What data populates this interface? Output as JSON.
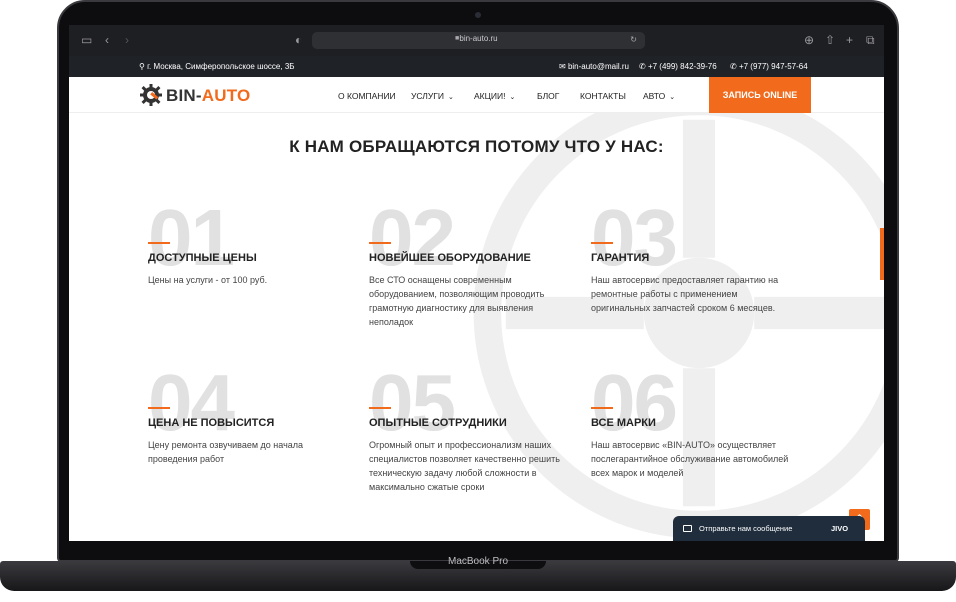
{
  "browser": {
    "url": "bin-auto.ru"
  },
  "topbar": {
    "address": "г. Москва, Симферопольское шоссе, 3Б",
    "email": "bin-auto@mail.ru",
    "phone1": "+7 (499) 842-39-76",
    "phone2": "+7 (977) 947-57-64"
  },
  "logo": {
    "part1": "BIN-",
    "part2": "AUTO"
  },
  "nav": {
    "items": [
      {
        "label": "О компании"
      },
      {
        "label": "Услуги"
      },
      {
        "label": "Акции!"
      },
      {
        "label": "Блог"
      },
      {
        "label": "Контакты"
      },
      {
        "label": "Авто"
      }
    ],
    "cta": "ЗАПИСЬ ONLINE"
  },
  "section": {
    "title": "К НАМ ОБРАЩАЮТСЯ ПОТОМУ ЧТО У НАС:",
    "features": [
      {
        "num": "01",
        "title": "Доступные цены",
        "text": "Цены на услуги - от 100 руб."
      },
      {
        "num": "02",
        "title": "Новейшее оборудование",
        "text": "Все СТО оснащены современным оборудованием, позволяющим проводить грамотную диагностику для выявления неполадок"
      },
      {
        "num": "03",
        "title": "Гарантия",
        "text": "Наш автосервис предоставляет гарантию на ремонтные работы с применением оригинальных запчастей сроком 6 месяцев."
      },
      {
        "num": "04",
        "title": "Цена не повысится",
        "text": "Цену ремонта озвучиваем до начала проведения работ"
      },
      {
        "num": "05",
        "title": "Опытные сотрудники",
        "text": "Огромный опыт и профессионализм наших специалистов позволяет качественно решить техническую задачу любой сложности в максимально сжатые сроки"
      },
      {
        "num": "06",
        "title": "Все марки",
        "text": "Наш автосервис «BIN-AUTO» осуществляет послегарантийное обслуживание автомобилей всех марок и моделей"
      }
    ]
  },
  "chat": {
    "label": "Отправьте нам сообщение",
    "brand": "JIVO"
  },
  "device": {
    "label": "MacBook Pro"
  },
  "colors": {
    "accent": "#f26a1b",
    "dark": "#1f2227"
  }
}
